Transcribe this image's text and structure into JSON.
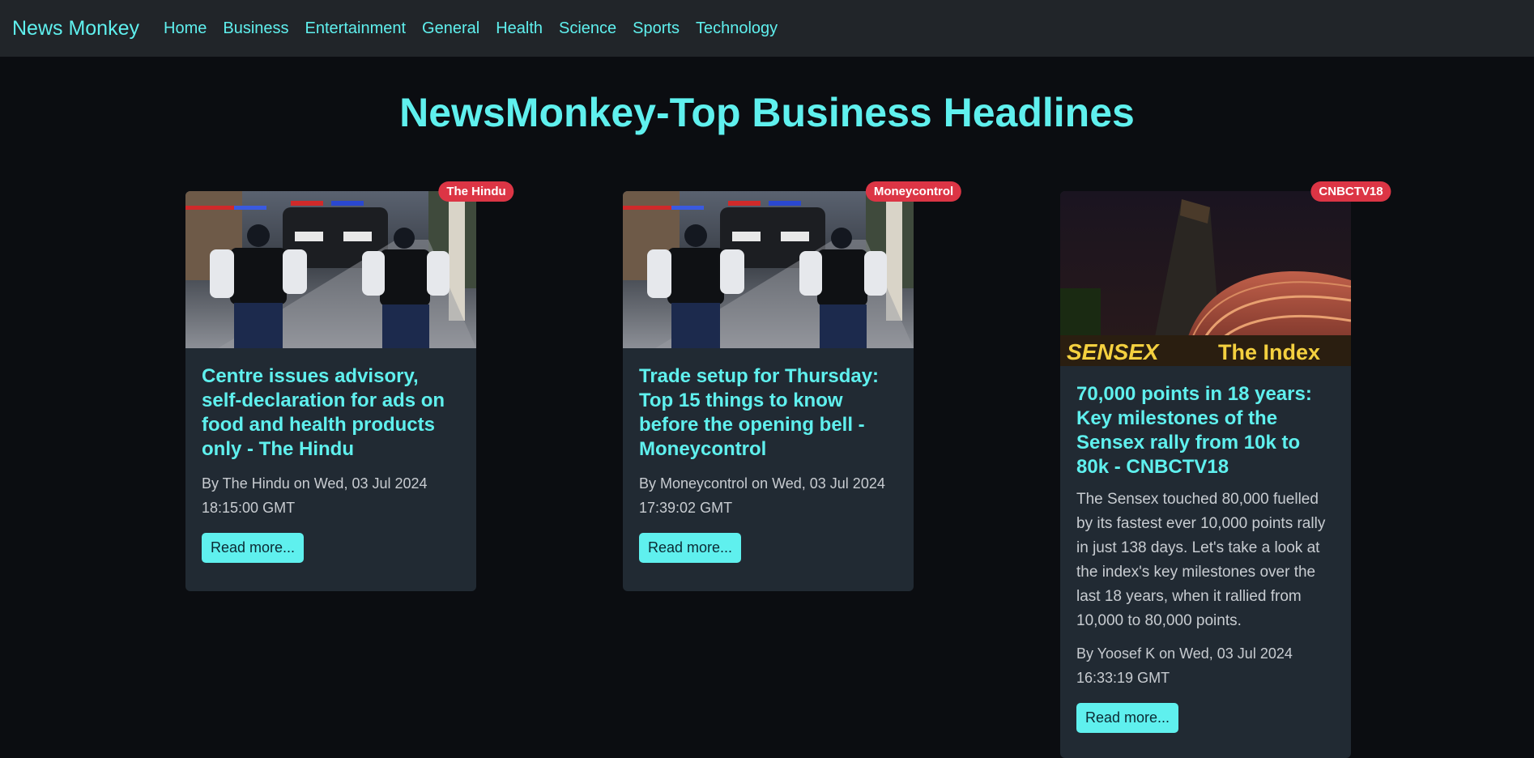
{
  "navbar": {
    "brand": "News Monkey",
    "links": [
      "Home",
      "Business",
      "Entertainment",
      "General",
      "Health",
      "Science",
      "Sports",
      "Technology"
    ]
  },
  "page_title": "NewsMonkey-Top Business Headlines",
  "articles": [
    {
      "source": "The Hindu",
      "title": "Centre issues advisory, self-declaration for ads on food and health products only - The Hindu",
      "description": "",
      "meta": "By The Hindu on Wed, 03 Jul 2024 18:15:00 GMT",
      "button": "Read more...",
      "image": "police-officers-photo"
    },
    {
      "source": "Moneycontrol",
      "title": "Trade setup for Thursday: Top 15 things to know before the opening bell - Moneycontrol",
      "description": "",
      "meta": "By Moneycontrol on Wed, 03 Jul 2024 17:39:02 GMT",
      "button": "Read more...",
      "image": "police-officers-photo"
    },
    {
      "source": "CNBCTV18",
      "title": "70,000 points in 18 years: Key milestones of the Sensex rally from 10k to 80k - CNBCTV18",
      "description": "The Sensex touched 80,000 fuelled by its fastest ever 10,000 points rally in just 138 days. Let's take a look at the index's key milestones over the last 18 years, when it rallied from 10,000 to 80,000 points.",
      "meta": "By Yoosef K on Wed, 03 Jul 2024 16:33:19 GMT",
      "button": "Read more...",
      "image": "sensex-building-photo",
      "image_text": [
        "SENSEX",
        "The Index"
      ]
    }
  ],
  "colors": {
    "accent": "#5ff0ee",
    "badge": "#dc3545",
    "card": "#212a33",
    "background": "#0b0d11",
    "navbar": "#212529"
  }
}
